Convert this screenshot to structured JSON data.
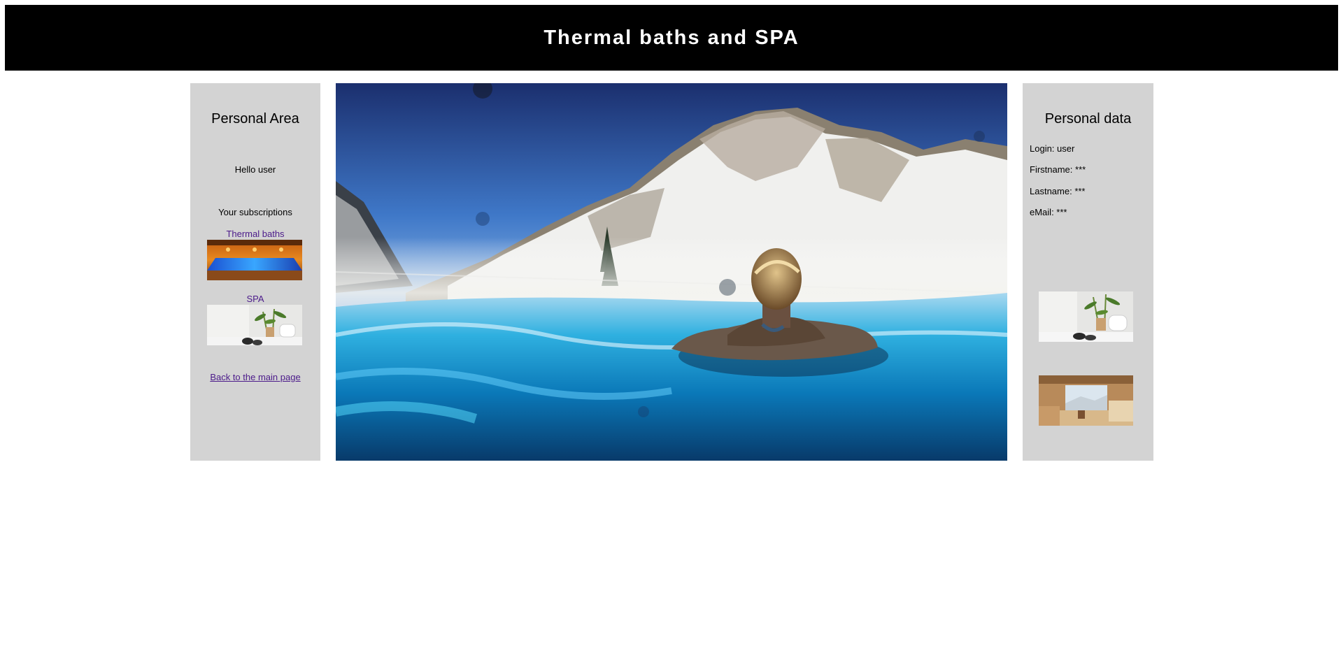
{
  "header": {
    "title": "Thermal baths and SPA"
  },
  "left_panel": {
    "title": "Personal Area",
    "greeting": "Hello user",
    "subscriptions_heading": "Your subscriptions",
    "subscriptions": [
      {
        "label": "Thermal baths"
      },
      {
        "label": "SPA"
      }
    ],
    "back_link": "Back to the main page"
  },
  "right_panel": {
    "title": "Personal data",
    "fields": [
      {
        "text": "Login: user"
      },
      {
        "text": "Firstname: ***"
      },
      {
        "text": "Lastname: ***"
      },
      {
        "text": "eMail: ***"
      }
    ]
  },
  "colors": {
    "header_bg": "#000000",
    "panel_bg": "#d3d3d3",
    "link": "#4b1a8a"
  }
}
